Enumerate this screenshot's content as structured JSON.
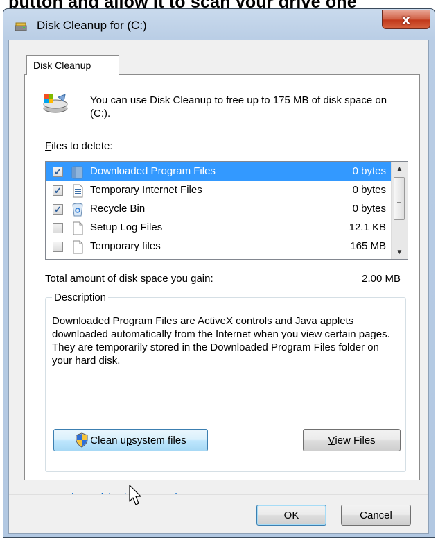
{
  "caption": "button and allow it to scan your drive one",
  "window": {
    "title": "Disk Cleanup for  (C:)",
    "close_glyph": "x"
  },
  "tabs": [
    {
      "label": "Disk Cleanup"
    }
  ],
  "intro": {
    "text": "You can use Disk Cleanup to free up to 175 MB of disk space on  (C:)."
  },
  "files": {
    "label_prefix": "F",
    "label_rest": "iles to delete:",
    "items": [
      {
        "name": "Downloaded Program Files",
        "size": "0 bytes",
        "checked": true,
        "selected": true,
        "icon": "folder-icon"
      },
      {
        "name": "Temporary Internet Files",
        "size": "0 bytes",
        "checked": true,
        "selected": false,
        "icon": "document-icon"
      },
      {
        "name": "Recycle Bin",
        "size": "0 bytes",
        "checked": true,
        "selected": false,
        "icon": "recycle-bin-icon"
      },
      {
        "name": "Setup Log Files",
        "size": "12.1 KB",
        "checked": false,
        "selected": false,
        "icon": "blank-file-icon"
      },
      {
        "name": "Temporary files",
        "size": "165 MB",
        "checked": false,
        "selected": false,
        "icon": "blank-file-icon"
      }
    ]
  },
  "total": {
    "label": "Total amount of disk space you gain:",
    "value": "2.00 MB"
  },
  "description": {
    "legend": "Description",
    "text": "Downloaded Program Files are ActiveX controls and Java applets downloaded automatically from the Internet when you view certain pages. They are temporarily stored in the Downloaded Program Files folder on your hard disk."
  },
  "buttons": {
    "cleanup_a": "Clean u",
    "cleanup_b": "p",
    "cleanup_c": " system files",
    "view_a": "V",
    "view_b": "iew Files",
    "ok": "OK",
    "cancel": "Cancel"
  },
  "help_link": "How does Disk Cleanup work?",
  "colors": {
    "selection": "#3399ff",
    "link": "#0066cc",
    "close_button": "#c23a1c"
  }
}
